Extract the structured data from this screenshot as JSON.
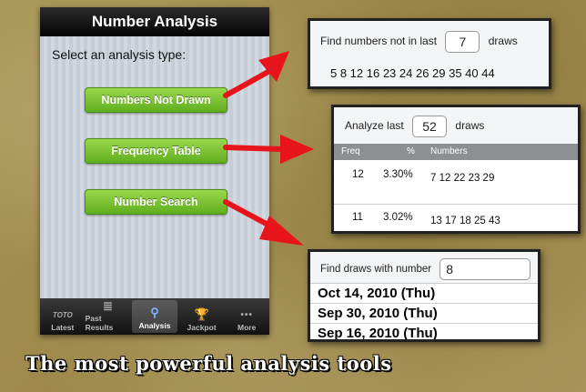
{
  "phone": {
    "title": "Number Analysis",
    "prompt": "Select an analysis type:",
    "buttons": [
      "Numbers Not Drawn",
      "Frequency Table",
      "Number Search"
    ],
    "tabs": [
      {
        "label": "Latest",
        "icon": "toto-logo-icon",
        "glyph": "TOTO"
      },
      {
        "label": "Past Results",
        "icon": "stack-icon",
        "glyph": "≣"
      },
      {
        "label": "Analysis",
        "icon": "analysis-magnifier-icon",
        "glyph": "⚲"
      },
      {
        "label": "Jackpot",
        "icon": "trophy-icon",
        "glyph": "🏆"
      },
      {
        "label": "More",
        "icon": "more-dots-icon",
        "glyph": "•••"
      }
    ],
    "active_tab": "Analysis"
  },
  "panel1": {
    "label_before": "Find numbers not in last",
    "value": "7",
    "label_after": "draws",
    "numbers": "5 8 12 16 23 24 26 29 35 40 44"
  },
  "panel2": {
    "label_before": "Analyze last",
    "value": "52",
    "label_after": "draws",
    "headers": [
      "Freq",
      "%",
      "Numbers"
    ],
    "rows": [
      {
        "freq": "12",
        "pct": "3.30%",
        "numbers": "7 12 22 23 29"
      },
      {
        "freq": "11",
        "pct": "3.02%",
        "numbers": "13 17 18 25 43"
      }
    ]
  },
  "panel3": {
    "label": "Find draws with number",
    "value": "8",
    "dates": [
      "Oct 14, 2010 (Thu)",
      "Sep 30, 2010 (Thu)",
      "Sep 16, 2010 (Thu)"
    ]
  },
  "tagline": "The most powerful analysis tools",
  "colors": {
    "arrow": "#e8141b",
    "button_green": "#6bbf22",
    "nav_black": "#111111"
  }
}
